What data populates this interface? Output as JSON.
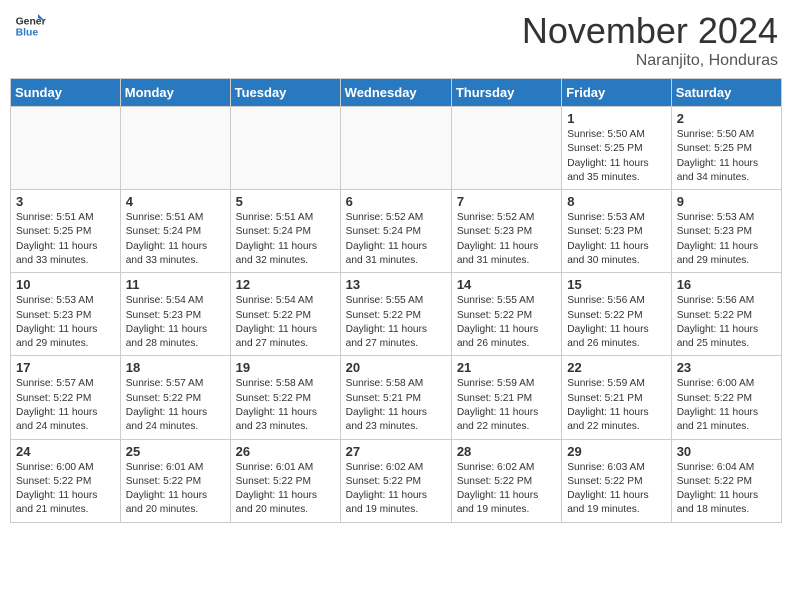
{
  "header": {
    "logo_line1": "General",
    "logo_line2": "Blue",
    "month": "November 2024",
    "location": "Naranjito, Honduras"
  },
  "weekdays": [
    "Sunday",
    "Monday",
    "Tuesday",
    "Wednesday",
    "Thursday",
    "Friday",
    "Saturday"
  ],
  "weeks": [
    [
      {
        "day": "",
        "info": ""
      },
      {
        "day": "",
        "info": ""
      },
      {
        "day": "",
        "info": ""
      },
      {
        "day": "",
        "info": ""
      },
      {
        "day": "",
        "info": ""
      },
      {
        "day": "1",
        "info": "Sunrise: 5:50 AM\nSunset: 5:25 PM\nDaylight: 11 hours\nand 35 minutes."
      },
      {
        "day": "2",
        "info": "Sunrise: 5:50 AM\nSunset: 5:25 PM\nDaylight: 11 hours\nand 34 minutes."
      }
    ],
    [
      {
        "day": "3",
        "info": "Sunrise: 5:51 AM\nSunset: 5:25 PM\nDaylight: 11 hours\nand 33 minutes."
      },
      {
        "day": "4",
        "info": "Sunrise: 5:51 AM\nSunset: 5:24 PM\nDaylight: 11 hours\nand 33 minutes."
      },
      {
        "day": "5",
        "info": "Sunrise: 5:51 AM\nSunset: 5:24 PM\nDaylight: 11 hours\nand 32 minutes."
      },
      {
        "day": "6",
        "info": "Sunrise: 5:52 AM\nSunset: 5:24 PM\nDaylight: 11 hours\nand 31 minutes."
      },
      {
        "day": "7",
        "info": "Sunrise: 5:52 AM\nSunset: 5:23 PM\nDaylight: 11 hours\nand 31 minutes."
      },
      {
        "day": "8",
        "info": "Sunrise: 5:53 AM\nSunset: 5:23 PM\nDaylight: 11 hours\nand 30 minutes."
      },
      {
        "day": "9",
        "info": "Sunrise: 5:53 AM\nSunset: 5:23 PM\nDaylight: 11 hours\nand 29 minutes."
      }
    ],
    [
      {
        "day": "10",
        "info": "Sunrise: 5:53 AM\nSunset: 5:23 PM\nDaylight: 11 hours\nand 29 minutes."
      },
      {
        "day": "11",
        "info": "Sunrise: 5:54 AM\nSunset: 5:23 PM\nDaylight: 11 hours\nand 28 minutes."
      },
      {
        "day": "12",
        "info": "Sunrise: 5:54 AM\nSunset: 5:22 PM\nDaylight: 11 hours\nand 27 minutes."
      },
      {
        "day": "13",
        "info": "Sunrise: 5:55 AM\nSunset: 5:22 PM\nDaylight: 11 hours\nand 27 minutes."
      },
      {
        "day": "14",
        "info": "Sunrise: 5:55 AM\nSunset: 5:22 PM\nDaylight: 11 hours\nand 26 minutes."
      },
      {
        "day": "15",
        "info": "Sunrise: 5:56 AM\nSunset: 5:22 PM\nDaylight: 11 hours\nand 26 minutes."
      },
      {
        "day": "16",
        "info": "Sunrise: 5:56 AM\nSunset: 5:22 PM\nDaylight: 11 hours\nand 25 minutes."
      }
    ],
    [
      {
        "day": "17",
        "info": "Sunrise: 5:57 AM\nSunset: 5:22 PM\nDaylight: 11 hours\nand 24 minutes."
      },
      {
        "day": "18",
        "info": "Sunrise: 5:57 AM\nSunset: 5:22 PM\nDaylight: 11 hours\nand 24 minutes."
      },
      {
        "day": "19",
        "info": "Sunrise: 5:58 AM\nSunset: 5:22 PM\nDaylight: 11 hours\nand 23 minutes."
      },
      {
        "day": "20",
        "info": "Sunrise: 5:58 AM\nSunset: 5:21 PM\nDaylight: 11 hours\nand 23 minutes."
      },
      {
        "day": "21",
        "info": "Sunrise: 5:59 AM\nSunset: 5:21 PM\nDaylight: 11 hours\nand 22 minutes."
      },
      {
        "day": "22",
        "info": "Sunrise: 5:59 AM\nSunset: 5:21 PM\nDaylight: 11 hours\nand 22 minutes."
      },
      {
        "day": "23",
        "info": "Sunrise: 6:00 AM\nSunset: 5:22 PM\nDaylight: 11 hours\nand 21 minutes."
      }
    ],
    [
      {
        "day": "24",
        "info": "Sunrise: 6:00 AM\nSunset: 5:22 PM\nDaylight: 11 hours\nand 21 minutes."
      },
      {
        "day": "25",
        "info": "Sunrise: 6:01 AM\nSunset: 5:22 PM\nDaylight: 11 hours\nand 20 minutes."
      },
      {
        "day": "26",
        "info": "Sunrise: 6:01 AM\nSunset: 5:22 PM\nDaylight: 11 hours\nand 20 minutes."
      },
      {
        "day": "27",
        "info": "Sunrise: 6:02 AM\nSunset: 5:22 PM\nDaylight: 11 hours\nand 19 minutes."
      },
      {
        "day": "28",
        "info": "Sunrise: 6:02 AM\nSunset: 5:22 PM\nDaylight: 11 hours\nand 19 minutes."
      },
      {
        "day": "29",
        "info": "Sunrise: 6:03 AM\nSunset: 5:22 PM\nDaylight: 11 hours\nand 19 minutes."
      },
      {
        "day": "30",
        "info": "Sunrise: 6:04 AM\nSunset: 5:22 PM\nDaylight: 11 hours\nand 18 minutes."
      }
    ]
  ]
}
